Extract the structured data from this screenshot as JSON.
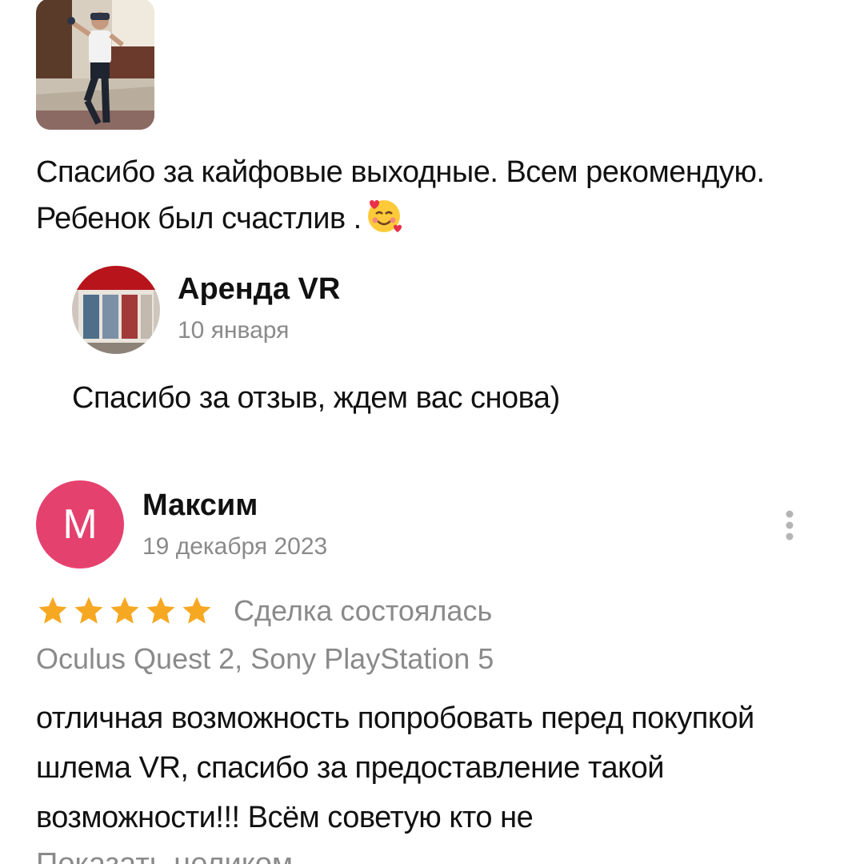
{
  "review1": {
    "text": "Спасибо за кайфовые выходные. Всем рекомендую. Ребенок был счастлив ."
  },
  "reply": {
    "name": "Аренда VR",
    "date": "10 января",
    "text": "Спасибо за отзыв, ждем вас снова)"
  },
  "review2": {
    "avatar_letter": "М",
    "avatar_color": "#e5416f",
    "author": "Максим",
    "date": "19 декабря 2023",
    "rating": 5,
    "rating_max": 5,
    "deal_status": "Сделка состоялась",
    "products": "Oculus Quest 2, Sony PlayStation 5",
    "text": "отличная возможность попробовать перед покупкой шлема VR, спасибо за предоставление такой возможности!!! Всём советую кто не",
    "show_more": "Показать целиком"
  },
  "colors": {
    "star": "#f7a823",
    "muted_text": "#8a8a8a"
  },
  "icons": [
    "smiling-face-with-hearts-icon",
    "more-vertical-icon",
    "star-icon"
  ]
}
